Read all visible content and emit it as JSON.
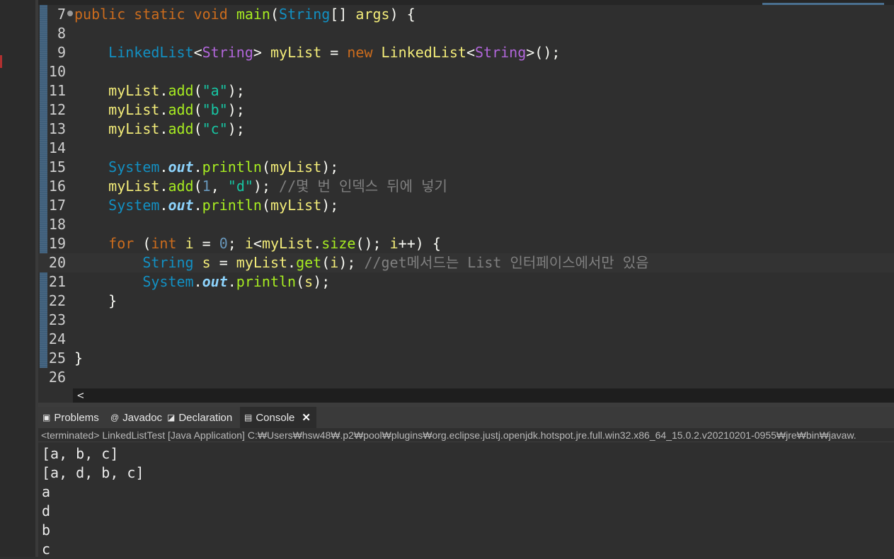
{
  "editor": {
    "lines": [
      {
        "num": "7",
        "segments": [
          [
            "kw",
            "public"
          ],
          [
            "par",
            " "
          ],
          [
            "kw",
            "static"
          ],
          [
            "par",
            " "
          ],
          [
            "kw",
            "void"
          ],
          [
            "par",
            " "
          ],
          [
            "mth",
            "main"
          ],
          [
            "par",
            "("
          ],
          [
            "cls",
            "String"
          ],
          [
            "par",
            "[] "
          ],
          [
            "var",
            "args"
          ],
          [
            "par",
            ") {"
          ]
        ]
      },
      {
        "num": "8",
        "segments": []
      },
      {
        "num": "9",
        "segments": [
          [
            "par",
            "    "
          ],
          [
            "cls",
            "LinkedList"
          ],
          [
            "par",
            "<"
          ],
          [
            "typ",
            "String"
          ],
          [
            "par",
            "> "
          ],
          [
            "var",
            "myList"
          ],
          [
            "par",
            " = "
          ],
          [
            "kw",
            "new"
          ],
          [
            "par",
            " "
          ],
          [
            "var",
            "LinkedList"
          ],
          [
            "par",
            "<"
          ],
          [
            "typ",
            "String"
          ],
          [
            "par",
            ">();"
          ]
        ]
      },
      {
        "num": "10",
        "segments": []
      },
      {
        "num": "11",
        "segments": [
          [
            "par",
            "    "
          ],
          [
            "var",
            "myList"
          ],
          [
            "par",
            "."
          ],
          [
            "mth",
            "add"
          ],
          [
            "par",
            "("
          ],
          [
            "str",
            "\"a\""
          ],
          [
            "par",
            ");"
          ]
        ]
      },
      {
        "num": "12",
        "segments": [
          [
            "par",
            "    "
          ],
          [
            "var",
            "myList"
          ],
          [
            "par",
            "."
          ],
          [
            "mth",
            "add"
          ],
          [
            "par",
            "("
          ],
          [
            "str",
            "\"b\""
          ],
          [
            "par",
            ");"
          ]
        ]
      },
      {
        "num": "13",
        "segments": [
          [
            "par",
            "    "
          ],
          [
            "var",
            "myList"
          ],
          [
            "par",
            "."
          ],
          [
            "mth",
            "add"
          ],
          [
            "par",
            "("
          ],
          [
            "str",
            "\"c\""
          ],
          [
            "par",
            ");"
          ]
        ]
      },
      {
        "num": "14",
        "segments": []
      },
      {
        "num": "15",
        "segments": [
          [
            "par",
            "    "
          ],
          [
            "cls",
            "System"
          ],
          [
            "par",
            "."
          ],
          [
            "fld",
            "out"
          ],
          [
            "par",
            "."
          ],
          [
            "mth",
            "println"
          ],
          [
            "par",
            "("
          ],
          [
            "var",
            "myList"
          ],
          [
            "par",
            ");"
          ]
        ]
      },
      {
        "num": "16",
        "segments": [
          [
            "par",
            "    "
          ],
          [
            "var",
            "myList"
          ],
          [
            "par",
            "."
          ],
          [
            "mth",
            "add"
          ],
          [
            "par",
            "("
          ],
          [
            "num",
            "1"
          ],
          [
            "par",
            ", "
          ],
          [
            "str",
            "\"d\""
          ],
          [
            "par",
            "); "
          ],
          [
            "cmt",
            "//몇 번 인덱스 뒤에 넣기"
          ]
        ]
      },
      {
        "num": "17",
        "segments": [
          [
            "par",
            "    "
          ],
          [
            "cls",
            "System"
          ],
          [
            "par",
            "."
          ],
          [
            "fld",
            "out"
          ],
          [
            "par",
            "."
          ],
          [
            "mth",
            "println"
          ],
          [
            "par",
            "("
          ],
          [
            "var",
            "myList"
          ],
          [
            "par",
            ");"
          ]
        ]
      },
      {
        "num": "18",
        "segments": []
      },
      {
        "num": "19",
        "segments": [
          [
            "par",
            "    "
          ],
          [
            "kw",
            "for"
          ],
          [
            "par",
            " ("
          ],
          [
            "kw",
            "int"
          ],
          [
            "par",
            " "
          ],
          [
            "var",
            "i"
          ],
          [
            "par",
            " = "
          ],
          [
            "num",
            "0"
          ],
          [
            "par",
            "; "
          ],
          [
            "var",
            "i"
          ],
          [
            "par",
            "<"
          ],
          [
            "var",
            "myList"
          ],
          [
            "par",
            "."
          ],
          [
            "mth",
            "size"
          ],
          [
            "par",
            "(); "
          ],
          [
            "var",
            "i"
          ],
          [
            "par",
            "++) {"
          ]
        ]
      },
      {
        "num": "20",
        "segments": [
          [
            "par",
            "        "
          ],
          [
            "cls",
            "String"
          ],
          [
            "par",
            " "
          ],
          [
            "var",
            "s"
          ],
          [
            "par",
            " = "
          ],
          [
            "var",
            "myList"
          ],
          [
            "par",
            "."
          ],
          [
            "mth",
            "get"
          ],
          [
            "par",
            "("
          ],
          [
            "var",
            "i"
          ],
          [
            "par",
            "); "
          ],
          [
            "cmt",
            "//get메서드는 List 인터페이스에서만 있음"
          ]
        ]
      },
      {
        "num": "21",
        "segments": [
          [
            "par",
            "        "
          ],
          [
            "cls",
            "System"
          ],
          [
            "par",
            "."
          ],
          [
            "fld",
            "out"
          ],
          [
            "par",
            "."
          ],
          [
            "mth",
            "println"
          ],
          [
            "par",
            "("
          ],
          [
            "var",
            "s"
          ],
          [
            "par",
            ");"
          ]
        ]
      },
      {
        "num": "22",
        "segments": [
          [
            "par",
            "    }"
          ]
        ]
      },
      {
        "num": "23",
        "segments": []
      },
      {
        "num": "24",
        "segments": []
      },
      {
        "num": "25",
        "segments": [
          [
            "par",
            "}"
          ]
        ]
      },
      {
        "num": "26",
        "segments": []
      }
    ],
    "scroll_left_arrow": "<"
  },
  "views": {
    "tabs": [
      {
        "label": "Problems",
        "icon": "problems-icon",
        "glyph": "▣"
      },
      {
        "label": "Javadoc",
        "icon": "javadoc-icon",
        "glyph": "@"
      },
      {
        "label": "Declaration",
        "icon": "declaration-icon",
        "glyph": "◪"
      },
      {
        "label": "Console",
        "icon": "console-icon",
        "glyph": "▤"
      }
    ],
    "close_glyph": "✕"
  },
  "console": {
    "launch_info": "<terminated> LinkedListTest [Java Application] C:₩Users₩hsw48₩.p2₩pool₩plugins₩org.eclipse.justj.openjdk.hotspot.jre.full.win32.x86_64_15.0.2.v20210201-0955₩jre₩bin₩javaw.",
    "output": [
      "[a, b, c]",
      "[a, d, b, c]",
      "a",
      "d",
      "b",
      "c"
    ]
  }
}
